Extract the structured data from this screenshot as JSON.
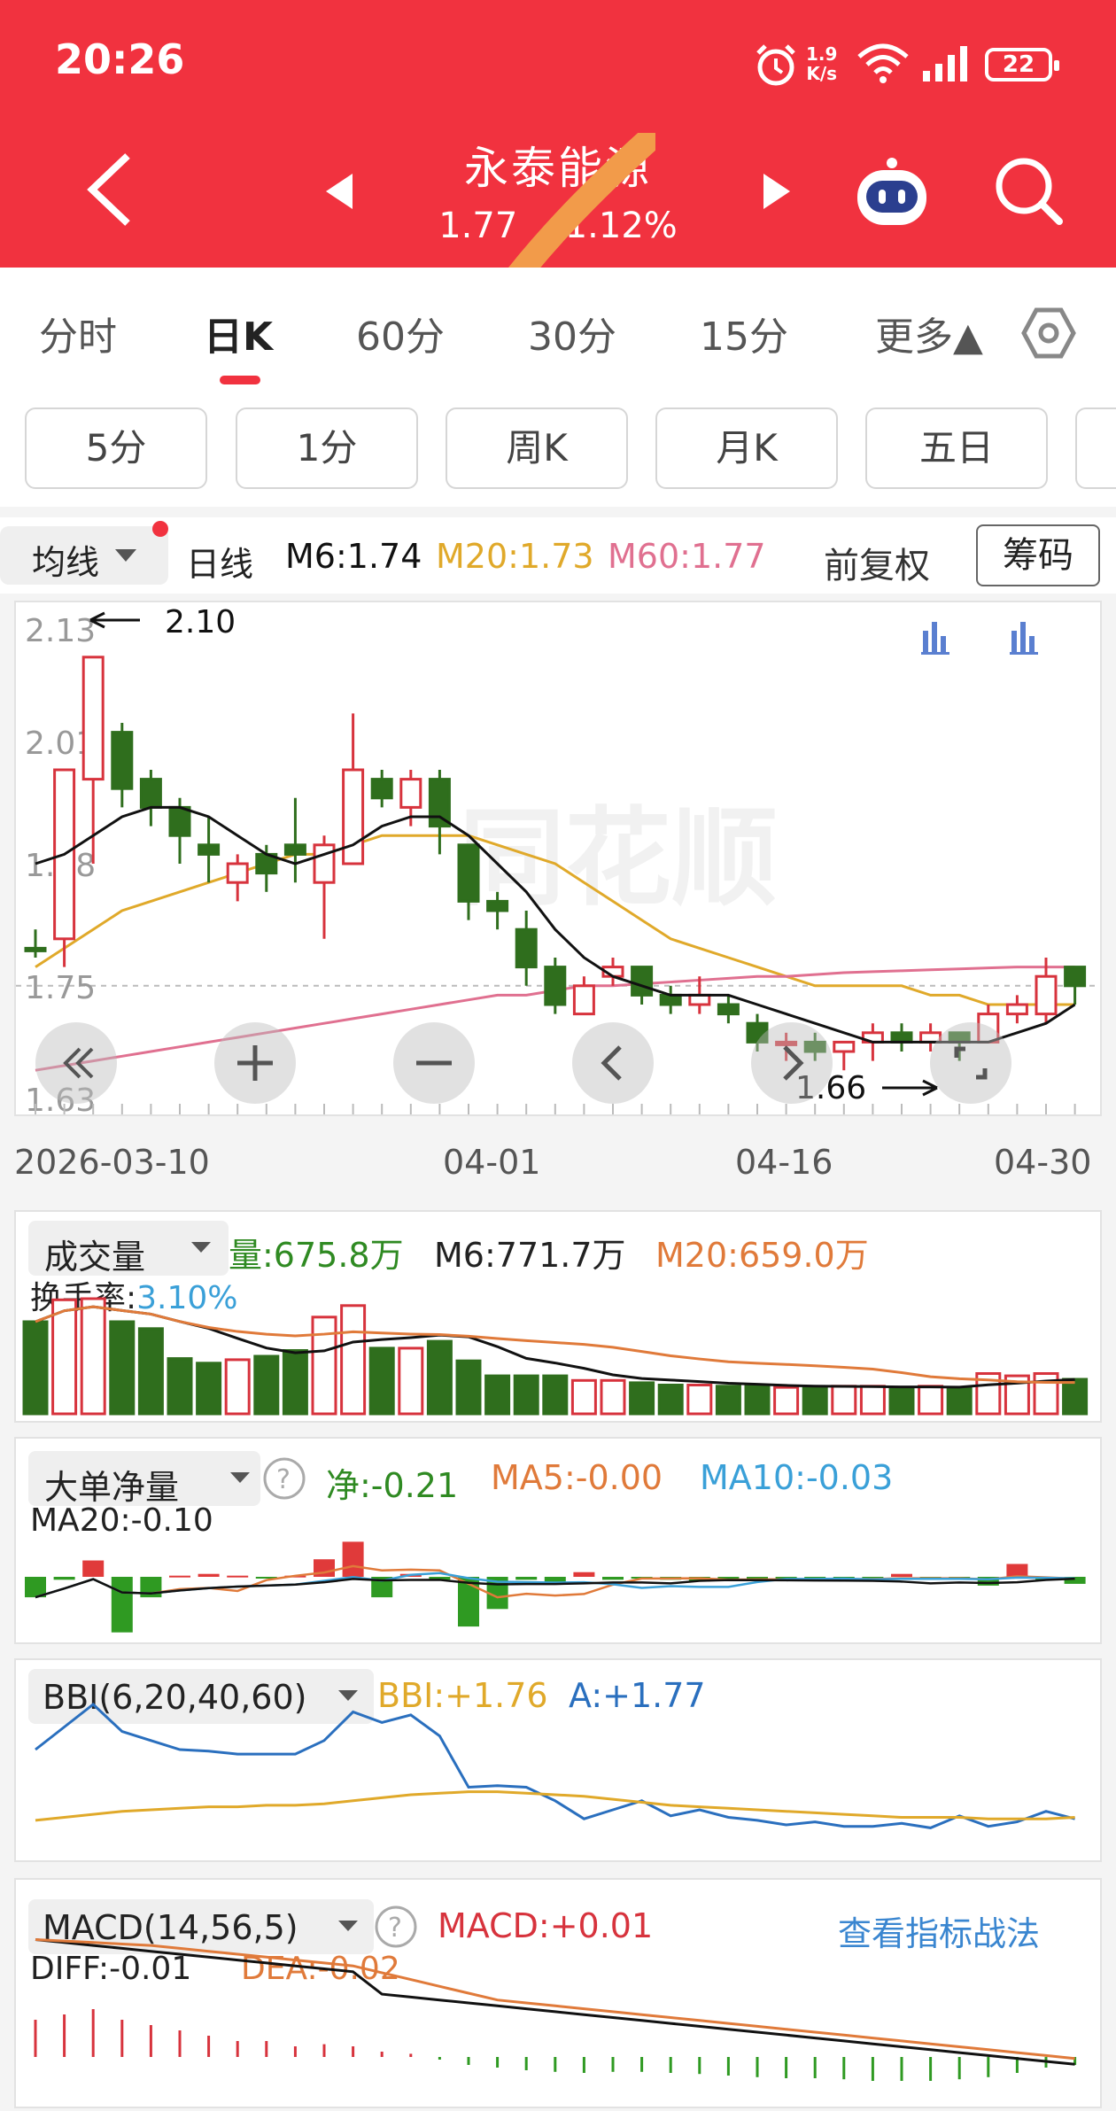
{
  "status": {
    "time": "20:26",
    "speed_value": "1.9",
    "speed_unit": "K/s",
    "battery": "22"
  },
  "header": {
    "title": "永泰能源",
    "price": "1.77",
    "change_pct": "1.12%"
  },
  "period_tabs": [
    "分时",
    "日K",
    "60分",
    "30分",
    "15分",
    "更多▲"
  ],
  "sub_tabs": [
    "5分",
    "1分",
    "周K",
    "月K",
    "五日"
  ],
  "ma_row": {
    "selector_label": "均线",
    "period_label": "日线",
    "m6": "M6:1.74",
    "m20": "M20:1.73",
    "m60": "M60:1.77",
    "adjust": "前复权",
    "chips_button": "筹码"
  },
  "kline": {
    "y_ticks": [
      "2.13",
      "2.01",
      "1.88",
      "1.75",
      "1.63"
    ],
    "max_label": "2.10",
    "min_label": "1.66",
    "dates": [
      "2026-03-10",
      "04-01",
      "04-16",
      "04-30"
    ]
  },
  "volume": {
    "selector_label": "成交量",
    "vol": "量:675.8万",
    "m6": "M6:771.7万",
    "m20": "M20:659.0万",
    "turnover_label": "换手率:",
    "turnover_value": "3.10%"
  },
  "bigorder": {
    "selector_label": "大单净量",
    "net": "净:-0.21",
    "ma5": "MA5:-0.00",
    "ma10": "MA10:-0.03",
    "ma20": "MA20:-0.10"
  },
  "bbi": {
    "selector_label": "BBI(6,20,40,60)",
    "bbi": "BBI:+1.76",
    "a": "A:+1.77"
  },
  "macd": {
    "selector_label": "MACD(14,56,5)",
    "macd": "MACD:+0.01",
    "link": "查看指标战法",
    "diff": "DIFF:-0.01",
    "dea": "DEA:-0.02"
  },
  "chart_data": {
    "type": "candlestick",
    "ylim": [
      1.63,
      2.13
    ],
    "colors": {
      "up": "#d7333d",
      "down": "#2f6e1d",
      "m6": "#111111",
      "m20": "#e0a92a",
      "m60": "#e07090"
    },
    "candles": [
      [
        1.79,
        1.79,
        1.81,
        1.78,
        0
      ],
      [
        1.8,
        1.98,
        1.81,
        1.77,
        1
      ],
      [
        1.97,
        2.1,
        1.88,
        2.01,
        1
      ],
      [
        2.02,
        1.96,
        2.03,
        1.94,
        0
      ],
      [
        1.97,
        1.94,
        1.98,
        1.92,
        0
      ],
      [
        1.94,
        1.91,
        1.95,
        1.88,
        0
      ],
      [
        1.9,
        1.89,
        1.93,
        1.86,
        0
      ],
      [
        1.86,
        1.88,
        1.89,
        1.84,
        1
      ],
      [
        1.89,
        1.87,
        1.9,
        1.85,
        0
      ],
      [
        1.89,
        1.9,
        1.95,
        1.86,
        0
      ],
      [
        1.86,
        1.9,
        1.91,
        1.8,
        1
      ],
      [
        1.88,
        1.98,
        2.04,
        1.88,
        1
      ],
      [
        1.97,
        1.95,
        1.98,
        1.94,
        0
      ],
      [
        1.94,
        1.97,
        1.98,
        1.92,
        1
      ],
      [
        1.97,
        1.92,
        1.98,
        1.89,
        0
      ],
      [
        1.9,
        1.84,
        1.9,
        1.82,
        0
      ],
      [
        1.84,
        1.83,
        1.85,
        1.81,
        0
      ],
      [
        1.81,
        1.77,
        1.83,
        1.75,
        0
      ],
      [
        1.77,
        1.73,
        1.78,
        1.72,
        0
      ],
      [
        1.72,
        1.75,
        1.76,
        1.72,
        1
      ],
      [
        1.76,
        1.77,
        1.78,
        1.75,
        1
      ],
      [
        1.77,
        1.74,
        1.77,
        1.73,
        0
      ],
      [
        1.74,
        1.73,
        1.75,
        1.72,
        0
      ],
      [
        1.74,
        1.73,
        1.76,
        1.72,
        1
      ],
      [
        1.73,
        1.72,
        1.74,
        1.71,
        0
      ],
      [
        1.71,
        1.69,
        1.72,
        1.68,
        0
      ],
      [
        1.69,
        1.69,
        1.7,
        1.67,
        1
      ],
      [
        1.69,
        1.68,
        1.7,
        1.67,
        0
      ],
      [
        1.68,
        1.69,
        1.69,
        1.66,
        1
      ],
      [
        1.69,
        1.7,
        1.71,
        1.67,
        1
      ],
      [
        1.7,
        1.69,
        1.71,
        1.68,
        0
      ],
      [
        1.69,
        1.7,
        1.71,
        1.68,
        1
      ],
      [
        1.7,
        1.69,
        1.7,
        1.67,
        0
      ],
      [
        1.69,
        1.72,
        1.73,
        1.69,
        1
      ],
      [
        1.72,
        1.73,
        1.74,
        1.71,
        1
      ],
      [
        1.72,
        1.76,
        1.78,
        1.71,
        1
      ],
      [
        1.77,
        1.75,
        1.77,
        1.73,
        0
      ]
    ],
    "m6": [
      1.88,
      1.89,
      1.91,
      1.93,
      1.94,
      1.94,
      1.93,
      1.91,
      1.89,
      1.88,
      1.89,
      1.9,
      1.92,
      1.93,
      1.93,
      1.91,
      1.88,
      1.85,
      1.81,
      1.78,
      1.76,
      1.75,
      1.74,
      1.74,
      1.74,
      1.73,
      1.72,
      1.71,
      1.7,
      1.69,
      1.69,
      1.69,
      1.69,
      1.69,
      1.7,
      1.71,
      1.73
    ],
    "m20": [
      1.77,
      1.79,
      1.81,
      1.83,
      1.84,
      1.85,
      1.86,
      1.87,
      1.88,
      1.89,
      1.89,
      1.9,
      1.91,
      1.91,
      1.91,
      1.91,
      1.9,
      1.89,
      1.88,
      1.86,
      1.84,
      1.82,
      1.8,
      1.79,
      1.78,
      1.77,
      1.76,
      1.75,
      1.75,
      1.75,
      1.75,
      1.74,
      1.74,
      1.73,
      1.73,
      1.73,
      1.73
    ],
    "m60": [
      1.66,
      1.665,
      1.67,
      1.675,
      1.68,
      1.685,
      1.69,
      1.695,
      1.7,
      1.705,
      1.71,
      1.715,
      1.72,
      1.725,
      1.73,
      1.735,
      1.74,
      1.74,
      1.745,
      1.75,
      1.75,
      1.752,
      1.754,
      1.756,
      1.758,
      1.76,
      1.76,
      1.762,
      1.764,
      1.765,
      1.766,
      1.767,
      1.768,
      1.769,
      1.77,
      1.77,
      1.77
    ],
    "volume_ratio": [
      0.8,
      0.99,
      1.0,
      0.8,
      0.74,
      0.48,
      0.44,
      0.47,
      0.5,
      0.55,
      0.84,
      0.94,
      0.57,
      0.57,
      0.63,
      0.46,
      0.33,
      0.33,
      0.33,
      0.29,
      0.29,
      0.27,
      0.25,
      0.25,
      0.24,
      0.24,
      0.23,
      0.23,
      0.24,
      0.24,
      0.22,
      0.24,
      0.22,
      0.35,
      0.33,
      0.35,
      0.3
    ],
    "bigorder_net": [
      -0.35,
      -0.05,
      0.28,
      -0.95,
      -0.35,
      0.02,
      0.05,
      0.02,
      -0.02,
      0.02,
      0.3,
      0.6,
      -0.35,
      0.05,
      -0.05,
      -0.85,
      -0.55,
      -0.05,
      -0.1,
      0.08,
      -0.05,
      -0.02,
      -0.05,
      -0.08,
      -0.05,
      -0.02,
      -0.02,
      -0.05,
      -0.05,
      -0.05,
      0.05,
      -0.02,
      -0.05,
      -0.15,
      0.22,
      -0.05,
      -0.12
    ],
    "bbi_line": [
      0.3,
      0.15,
      0.0,
      0.18,
      0.24,
      0.3,
      0.31,
      0.33,
      0.33,
      0.33,
      0.24,
      0.05,
      0.12,
      0.07,
      0.21,
      0.55,
      0.54,
      0.55,
      0.64,
      0.76,
      0.7,
      0.64,
      0.74,
      0.7,
      0.75,
      0.77,
      0.8,
      0.78,
      0.81,
      0.81,
      0.79,
      0.82,
      0.74,
      0.81,
      0.78,
      0.71,
      0.76
    ],
    "bbi_avg": [
      0.77,
      0.75,
      0.73,
      0.71,
      0.7,
      0.69,
      0.68,
      0.68,
      0.67,
      0.67,
      0.66,
      0.64,
      0.62,
      0.6,
      0.59,
      0.58,
      0.58,
      0.59,
      0.6,
      0.61,
      0.63,
      0.65,
      0.67,
      0.68,
      0.69,
      0.7,
      0.71,
      0.72,
      0.73,
      0.74,
      0.75,
      0.75,
      0.75,
      0.76,
      0.76,
      0.76,
      0.75
    ],
    "macd_bars": [
      0.35,
      0.4,
      0.45,
      0.35,
      0.3,
      0.25,
      0.2,
      0.15,
      0.15,
      0.1,
      0.12,
      0.1,
      0.05,
      0.03,
      -0.05,
      -0.15,
      -0.2,
      -0.25,
      -0.28,
      -0.3,
      -0.28,
      -0.28,
      -0.3,
      -0.32,
      -0.35,
      -0.38,
      -0.4,
      -0.4,
      -0.42,
      -0.45,
      -0.45,
      -0.45,
      -0.42,
      -0.38,
      -0.3,
      -0.2,
      -0.15
    ]
  }
}
